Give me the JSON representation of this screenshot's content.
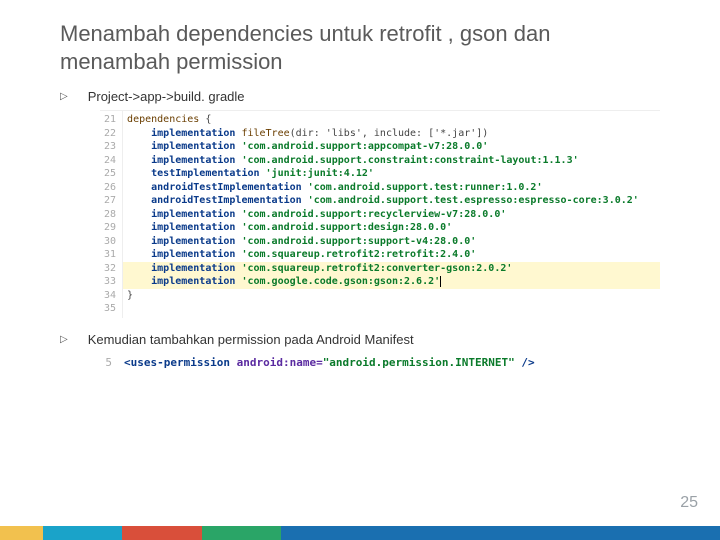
{
  "title": "Menambah dependencies untuk retrofit , gson dan menambah permission",
  "bullets": {
    "first": "Project->app->build. gradle",
    "second": "Kemudian tambahkan permission pada Android Manifest"
  },
  "gradle": {
    "lines": [
      {
        "n": "21",
        "indent": "",
        "keyword": "",
        "fn": "dependencies",
        "str": "",
        "tail": " {",
        "hl": false
      },
      {
        "n": "22",
        "indent": "    ",
        "keyword": "implementation",
        "fn": " fileTree",
        "str": "",
        "tail": "(dir: 'libs', include: ['*.jar'])",
        "hl": false
      },
      {
        "n": "23",
        "indent": "    ",
        "keyword": "implementation",
        "fn": "",
        "str": " 'com.android.support:appcompat-v7:28.0.0'",
        "tail": "",
        "hl": false
      },
      {
        "n": "24",
        "indent": "    ",
        "keyword": "implementation",
        "fn": "",
        "str": " 'com.android.support.constraint:constraint-layout:1.1.3'",
        "tail": "",
        "hl": false
      },
      {
        "n": "25",
        "indent": "    ",
        "keyword": "testImplementation",
        "fn": "",
        "str": " 'junit:junit:4.12'",
        "tail": "",
        "hl": false
      },
      {
        "n": "26",
        "indent": "    ",
        "keyword": "androidTestImplementation",
        "fn": "",
        "str": " 'com.android.support.test:runner:1.0.2'",
        "tail": "",
        "hl": false
      },
      {
        "n": "27",
        "indent": "    ",
        "keyword": "androidTestImplementation",
        "fn": "",
        "str": " 'com.android.support.test.espresso:espresso-core:3.0.2'",
        "tail": "",
        "hl": false
      },
      {
        "n": "28",
        "indent": "    ",
        "keyword": "implementation",
        "fn": "",
        "str": " 'com.android.support:recyclerview-v7:28.0.0'",
        "tail": "",
        "hl": false
      },
      {
        "n": "29",
        "indent": "    ",
        "keyword": "implementation",
        "fn": "",
        "str": " 'com.android.support:design:28.0.0'",
        "tail": "",
        "hl": false
      },
      {
        "n": "30",
        "indent": "    ",
        "keyword": "implementation",
        "fn": "",
        "str": " 'com.android.support:support-v4:28.0.0'",
        "tail": "",
        "hl": false
      },
      {
        "n": "31",
        "indent": "    ",
        "keyword": "implementation",
        "fn": "",
        "str": " 'com.squareup.retrofit2:retrofit:2.4.0'",
        "tail": "",
        "hl": false
      },
      {
        "n": "32",
        "indent": "    ",
        "keyword": "implementation",
        "fn": "",
        "str": " 'com.squareup.retrofit2:converter-gson:2.0.2'",
        "tail": "",
        "hl": true
      },
      {
        "n": "33",
        "indent": "    ",
        "keyword": "implementation",
        "fn": "",
        "str": " 'com.google.code.gson:gson:2.6.2'",
        "tail": "",
        "hl": true,
        "cursor": true
      },
      {
        "n": "34",
        "indent": "",
        "keyword": "",
        "fn": "",
        "str": "",
        "tail": "}",
        "hl": false
      },
      {
        "n": "35",
        "indent": "",
        "keyword": "",
        "fn": "",
        "str": "",
        "tail": "",
        "hl": false
      }
    ]
  },
  "manifest": {
    "lineNumber": "5",
    "open": "<",
    "tag": "uses-permission",
    "space": " ",
    "attrName": "android:name=",
    "attrValue": "\"android.permission.INTERNET\"",
    "close": " />"
  },
  "page": "25"
}
